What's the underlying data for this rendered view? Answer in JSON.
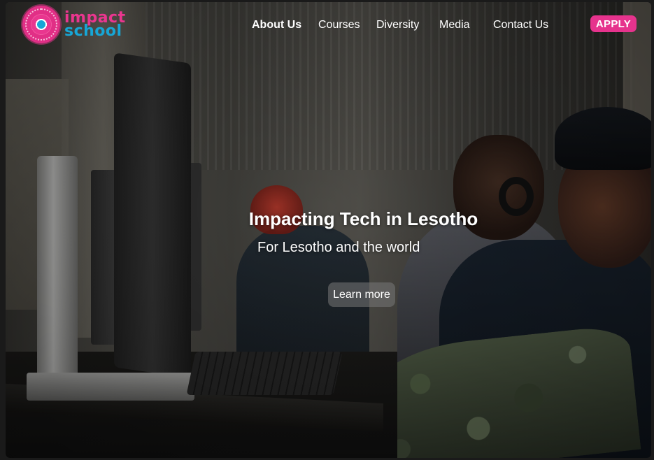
{
  "brand": {
    "line1": "impact",
    "line2": "school",
    "logo_icon": "impact-school-logo-icon",
    "colors": {
      "pink": "#e6338d",
      "blue": "#17a6d6"
    }
  },
  "nav": {
    "items": [
      {
        "label": "About Us",
        "active": true
      },
      {
        "label": "Courses",
        "active": false
      },
      {
        "label": "Diversity",
        "active": false
      },
      {
        "label": "Media",
        "active": false
      },
      {
        "label": "Contact Us",
        "active": false
      }
    ],
    "apply_label": "APPLY"
  },
  "hero": {
    "title": "Impacting Tech in Lesotho",
    "subtitle": "For Lesotho and the world",
    "cta_label": "Learn more"
  }
}
